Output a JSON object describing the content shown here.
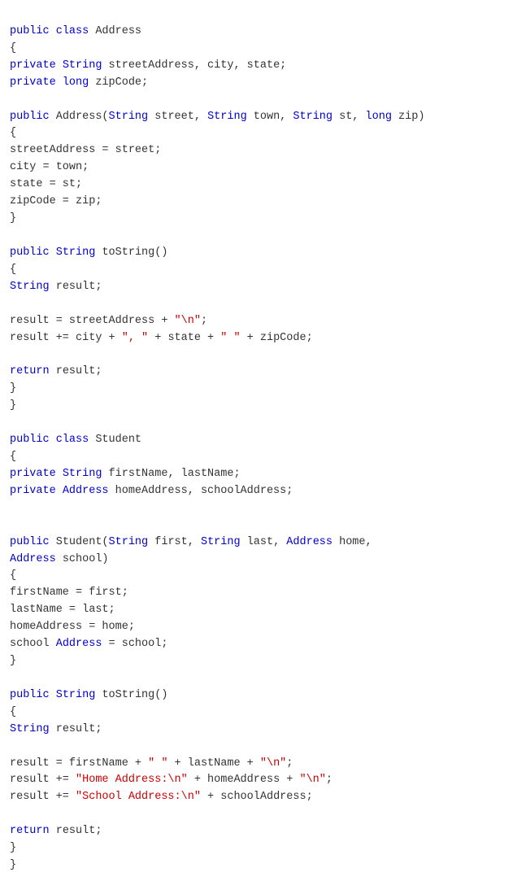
{
  "code": {
    "lines": [
      {
        "segments": [
          {
            "text": "public ",
            "style": "kw"
          },
          {
            "text": "class ",
            "style": "kw"
          },
          {
            "text": "Address",
            "style": "plain"
          }
        ]
      },
      {
        "segments": [
          {
            "text": "{",
            "style": "plain"
          }
        ]
      },
      {
        "segments": [
          {
            "text": "private ",
            "style": "kw"
          },
          {
            "text": "String ",
            "style": "type"
          },
          {
            "text": "streetAddress, city, state;",
            "style": "plain"
          }
        ]
      },
      {
        "segments": [
          {
            "text": "private ",
            "style": "kw"
          },
          {
            "text": "long ",
            "style": "type"
          },
          {
            "text": "zipCode;",
            "style": "plain"
          }
        ]
      },
      {
        "segments": [
          {
            "text": "",
            "style": "plain"
          }
        ]
      },
      {
        "segments": [
          {
            "text": "public ",
            "style": "kw"
          },
          {
            "text": "Address(",
            "style": "plain"
          },
          {
            "text": "String ",
            "style": "type"
          },
          {
            "text": "street, ",
            "style": "plain"
          },
          {
            "text": "String ",
            "style": "type"
          },
          {
            "text": "town, ",
            "style": "plain"
          },
          {
            "text": "String ",
            "style": "type"
          },
          {
            "text": "st, ",
            "style": "plain"
          },
          {
            "text": "long ",
            "style": "type"
          },
          {
            "text": "zip)",
            "style": "plain"
          }
        ]
      },
      {
        "segments": [
          {
            "text": "{",
            "style": "plain"
          }
        ]
      },
      {
        "segments": [
          {
            "text": "streetAddress = street;",
            "style": "plain"
          }
        ]
      },
      {
        "segments": [
          {
            "text": "city = town;",
            "style": "plain"
          }
        ]
      },
      {
        "segments": [
          {
            "text": "state = st;",
            "style": "plain"
          }
        ]
      },
      {
        "segments": [
          {
            "text": "zipCode = zip;",
            "style": "plain"
          }
        ]
      },
      {
        "segments": [
          {
            "text": "}",
            "style": "plain"
          }
        ]
      },
      {
        "segments": [
          {
            "text": "",
            "style": "plain"
          }
        ]
      },
      {
        "segments": [
          {
            "text": "public ",
            "style": "kw"
          },
          {
            "text": "String ",
            "style": "type"
          },
          {
            "text": "toString()",
            "style": "plain"
          }
        ]
      },
      {
        "segments": [
          {
            "text": "{",
            "style": "plain"
          }
        ]
      },
      {
        "segments": [
          {
            "text": "String ",
            "style": "type"
          },
          {
            "text": "result;",
            "style": "plain"
          }
        ]
      },
      {
        "segments": [
          {
            "text": "",
            "style": "plain"
          }
        ]
      },
      {
        "segments": [
          {
            "text": "result = streetAddress + ",
            "style": "plain"
          },
          {
            "text": "\"\\n\"",
            "style": "plain"
          },
          {
            "text": ";",
            "style": "plain"
          }
        ]
      },
      {
        "segments": [
          {
            "text": "result += city + ",
            "style": "plain"
          },
          {
            "text": "\", \"",
            "style": "plain"
          },
          {
            "text": " + state + ",
            "style": "plain"
          },
          {
            "text": "\" \"",
            "style": "plain"
          },
          {
            "text": " + zipCode;",
            "style": "plain"
          }
        ]
      },
      {
        "segments": [
          {
            "text": "",
            "style": "plain"
          }
        ]
      },
      {
        "segments": [
          {
            "text": "return ",
            "style": "kw"
          },
          {
            "text": "result;",
            "style": "plain"
          }
        ]
      },
      {
        "segments": [
          {
            "text": "}",
            "style": "plain"
          }
        ]
      },
      {
        "segments": [
          {
            "text": "}",
            "style": "plain"
          }
        ]
      },
      {
        "segments": [
          {
            "text": "",
            "style": "plain"
          }
        ]
      },
      {
        "segments": [
          {
            "text": "public ",
            "style": "kw"
          },
          {
            "text": "class ",
            "style": "kw"
          },
          {
            "text": "Student",
            "style": "plain"
          }
        ]
      },
      {
        "segments": [
          {
            "text": "{",
            "style": "plain"
          }
        ]
      },
      {
        "segments": [
          {
            "text": "private ",
            "style": "kw"
          },
          {
            "text": "String ",
            "style": "type"
          },
          {
            "text": "firstName, lastName;",
            "style": "plain"
          }
        ]
      },
      {
        "segments": [
          {
            "text": "private ",
            "style": "kw"
          },
          {
            "text": "Address ",
            "style": "type"
          },
          {
            "text": "homeAddress, schoolAddress;",
            "style": "plain"
          }
        ]
      },
      {
        "segments": [
          {
            "text": "",
            "style": "plain"
          }
        ]
      },
      {
        "segments": [
          {
            "text": "",
            "style": "plain"
          }
        ]
      },
      {
        "segments": [
          {
            "text": "public ",
            "style": "kw"
          },
          {
            "text": "Student(",
            "style": "plain"
          },
          {
            "text": "String ",
            "style": "type"
          },
          {
            "text": "first, ",
            "style": "plain"
          },
          {
            "text": "String ",
            "style": "type"
          },
          {
            "text": "last, ",
            "style": "plain"
          },
          {
            "text": "Address ",
            "style": "type"
          },
          {
            "text": "home,",
            "style": "plain"
          }
        ]
      },
      {
        "segments": [
          {
            "text": "Address ",
            "style": "type"
          },
          {
            "text": "school)",
            "style": "plain"
          }
        ]
      },
      {
        "segments": [
          {
            "text": "{",
            "style": "plain"
          }
        ]
      },
      {
        "segments": [
          {
            "text": "firstName = first;",
            "style": "plain"
          }
        ]
      },
      {
        "segments": [
          {
            "text": "lastName = last;",
            "style": "plain"
          }
        ]
      },
      {
        "segments": [
          {
            "text": "homeAddress = home;",
            "style": "plain"
          }
        ]
      },
      {
        "segments": [
          {
            "text": "school ",
            "style": "plain"
          },
          {
            "text": "Address ",
            "style": "type"
          },
          {
            "text": "= school;",
            "style": "plain"
          }
        ]
      },
      {
        "segments": [
          {
            "text": "}",
            "style": "plain"
          }
        ]
      },
      {
        "segments": [
          {
            "text": "",
            "style": "plain"
          }
        ]
      },
      {
        "segments": [
          {
            "text": "public ",
            "style": "kw"
          },
          {
            "text": "String ",
            "style": "type"
          },
          {
            "text": "toString()",
            "style": "plain"
          }
        ]
      },
      {
        "segments": [
          {
            "text": "{",
            "style": "plain"
          }
        ]
      },
      {
        "segments": [
          {
            "text": "String ",
            "style": "type"
          },
          {
            "text": "result;",
            "style": "plain"
          }
        ]
      },
      {
        "segments": [
          {
            "text": "",
            "style": "plain"
          }
        ]
      },
      {
        "segments": [
          {
            "text": "result = firstName + ",
            "style": "plain"
          },
          {
            "text": "\" \"",
            "style": "plain"
          },
          {
            "text": " + lastName + ",
            "style": "plain"
          },
          {
            "text": "\"\\n\"",
            "style": "plain"
          },
          {
            "text": ";",
            "style": "plain"
          }
        ]
      },
      {
        "segments": [
          {
            "text": "result += ",
            "style": "plain"
          },
          {
            "text": "\"Home Address:\\n\"",
            "style": "plain"
          },
          {
            "text": " + homeAddress + ",
            "style": "plain"
          },
          {
            "text": "\"\\n\"",
            "style": "plain"
          },
          {
            "text": ";",
            "style": "plain"
          }
        ]
      },
      {
        "segments": [
          {
            "text": "result += ",
            "style": "plain"
          },
          {
            "text": "\"School Address:\\n\"",
            "style": "plain"
          },
          {
            "text": " + schoolAddress;",
            "style": "plain"
          }
        ]
      },
      {
        "segments": [
          {
            "text": "",
            "style": "plain"
          }
        ]
      },
      {
        "segments": [
          {
            "text": "return ",
            "style": "kw"
          },
          {
            "text": "result;",
            "style": "plain"
          }
        ]
      },
      {
        "segments": [
          {
            "text": "}",
            "style": "plain"
          }
        ]
      },
      {
        "segments": [
          {
            "text": "}",
            "style": "plain"
          }
        ]
      }
    ]
  }
}
